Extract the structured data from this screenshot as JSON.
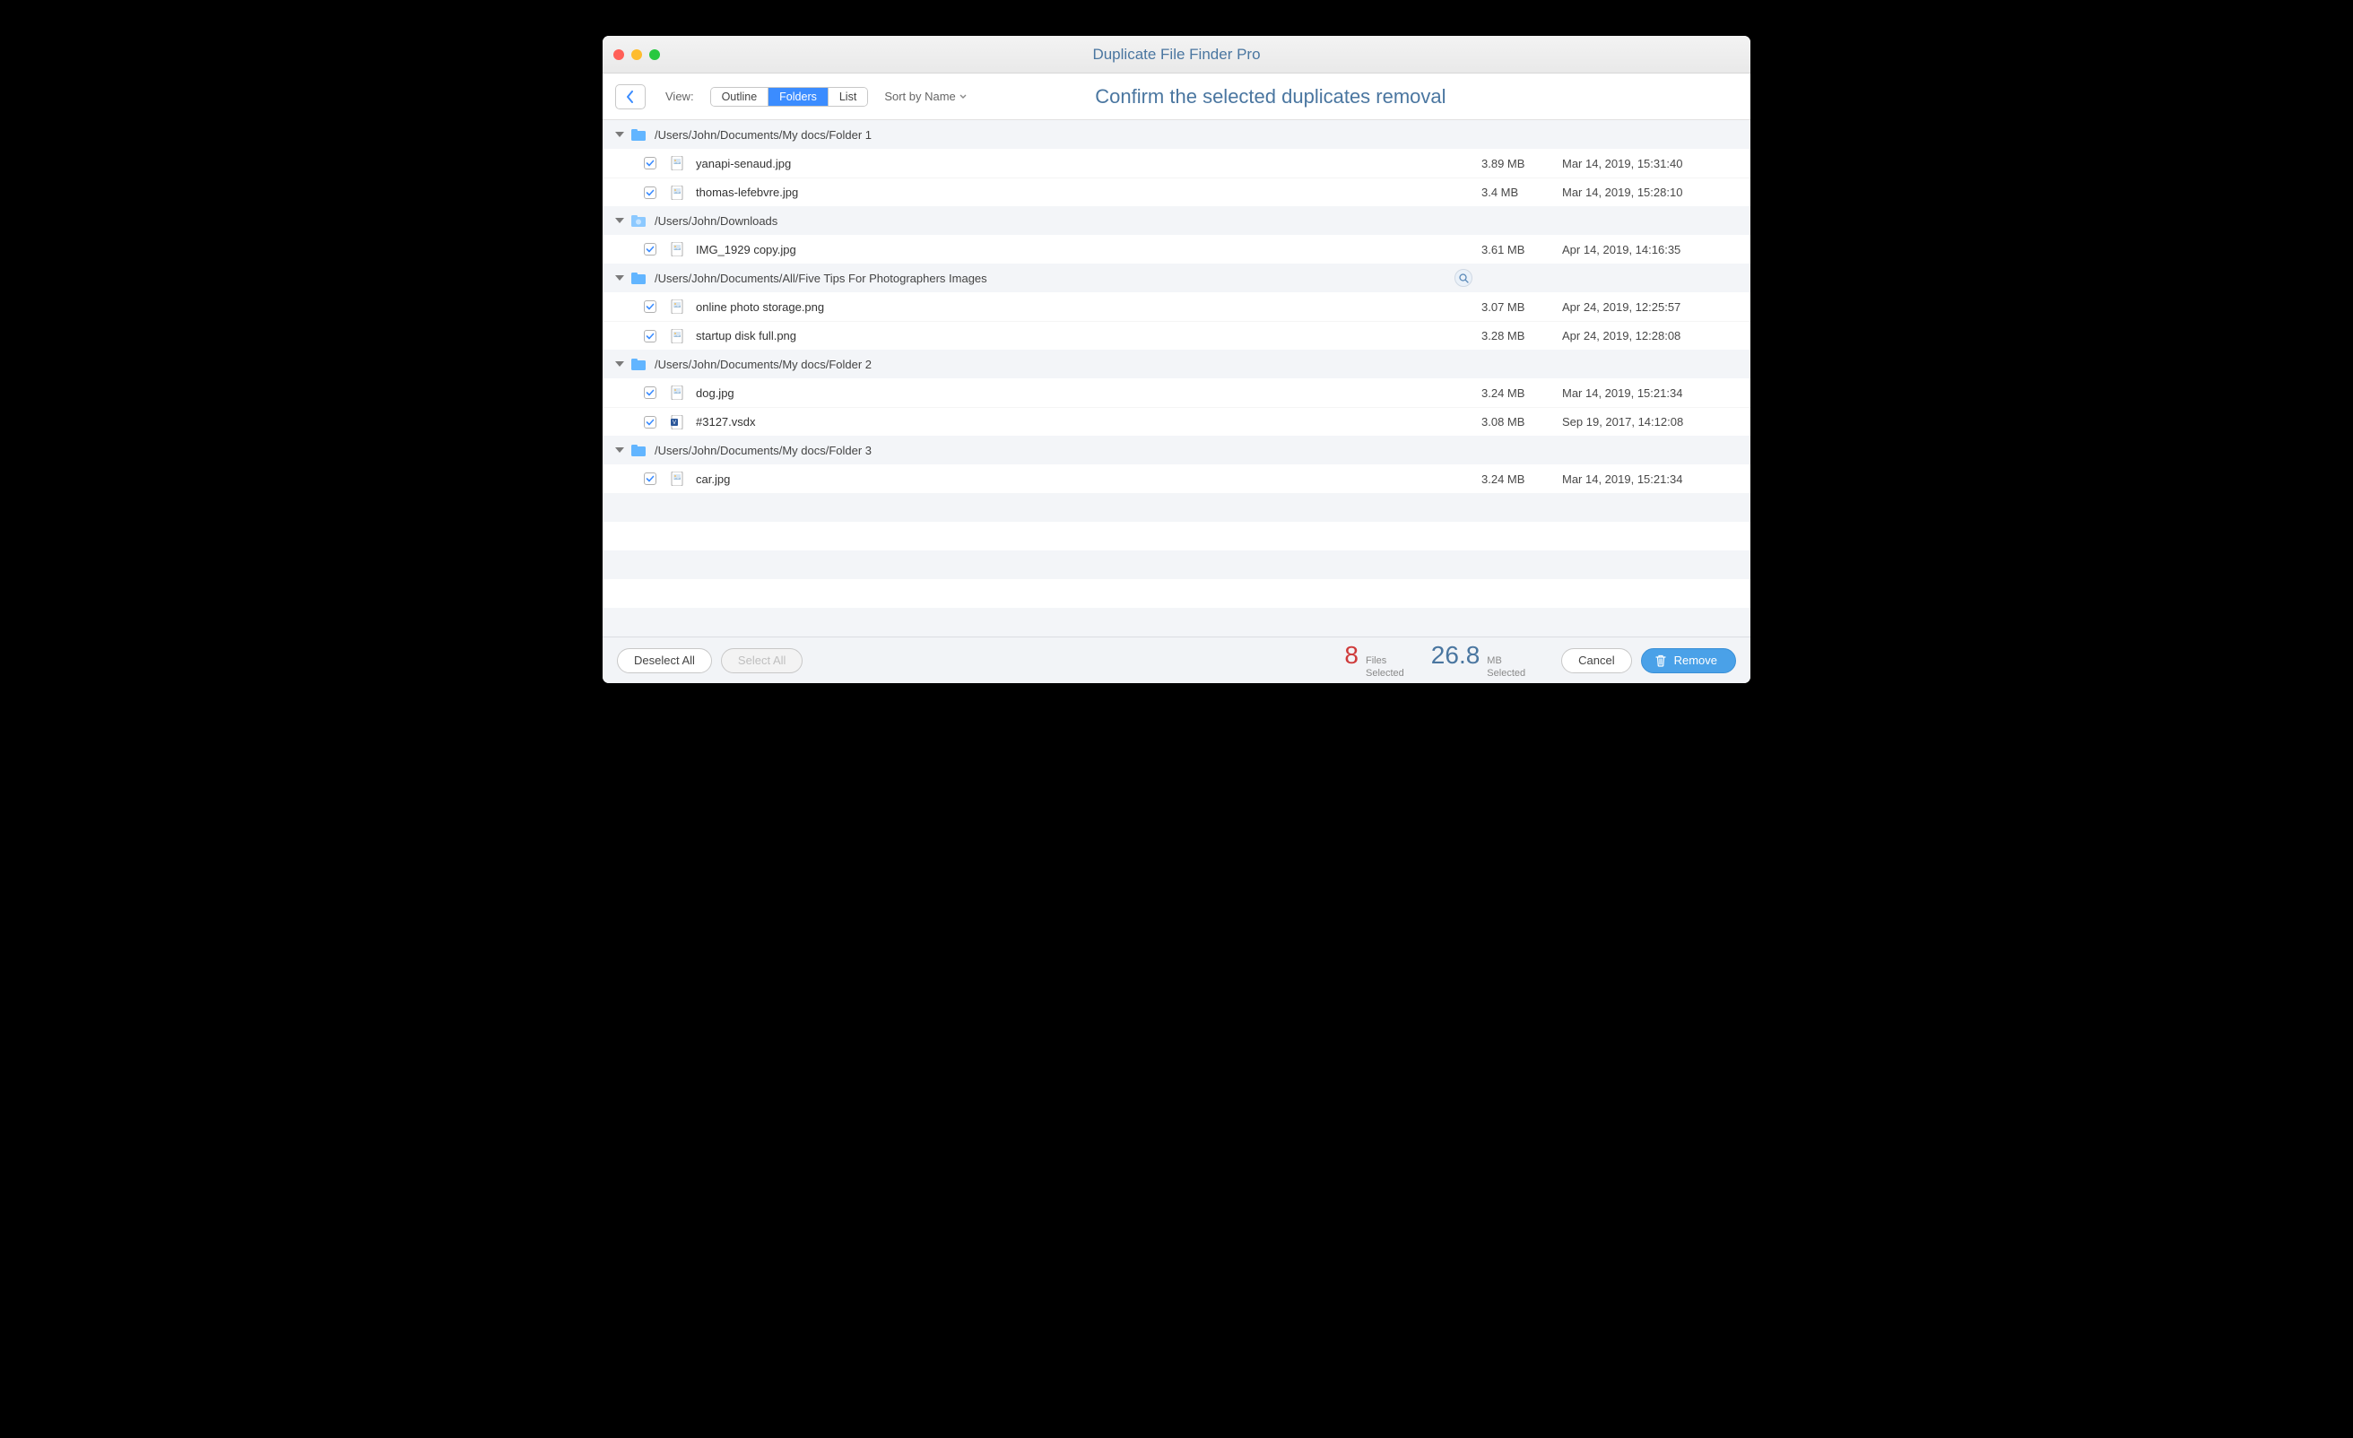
{
  "window": {
    "title": "Duplicate File Finder Pro"
  },
  "toolbar": {
    "view_label": "View:",
    "seg": {
      "outline": "Outline",
      "folders": "Folders",
      "list": "List"
    },
    "sort_label": "Sort by Name",
    "heading": "Confirm the selected duplicates removal"
  },
  "groups": [
    {
      "path": "/Users/John/Documents/My docs/Folder 1",
      "icon": "folder",
      "files": [
        {
          "name": "yanapi-senaud.jpg",
          "size": "3.89 MB",
          "date": "Mar 14, 2019, 15:31:40",
          "type": "image"
        },
        {
          "name": "thomas-lefebvre.jpg",
          "size": "3.4 MB",
          "date": "Mar 14, 2019, 15:28:10",
          "type": "image"
        }
      ]
    },
    {
      "path": "/Users/John/Downloads",
      "icon": "downloads",
      "files": [
        {
          "name": "IMG_1929 copy.jpg",
          "size": "3.61 MB",
          "date": "Apr 14, 2019, 14:16:35",
          "type": "image"
        }
      ]
    },
    {
      "path": "/Users/John/Documents/All/Five Tips For Photographers Images",
      "icon": "folder",
      "magnify": true,
      "files": [
        {
          "name": "online photo storage.png",
          "size": "3.07 MB",
          "date": "Apr 24, 2019, 12:25:57",
          "type": "image"
        },
        {
          "name": "startup disk full.png",
          "size": "3.28 MB",
          "date": "Apr 24, 2019, 12:28:08",
          "type": "image"
        }
      ]
    },
    {
      "path": "/Users/John/Documents/My docs/Folder 2",
      "icon": "folder",
      "files": [
        {
          "name": "dog.jpg",
          "size": "3.24 MB",
          "date": "Mar 14, 2019, 15:21:34",
          "type": "image"
        },
        {
          "name": "#3127.vsdx",
          "size": "3.08 MB",
          "date": "Sep 19, 2017, 14:12:08",
          "type": "visio"
        }
      ]
    },
    {
      "path": "/Users/John/Documents/My docs/Folder 3",
      "icon": "folder",
      "files": [
        {
          "name": "car.jpg",
          "size": "3.24 MB",
          "date": "Mar 14, 2019, 15:21:34",
          "type": "image"
        }
      ]
    }
  ],
  "footer": {
    "deselect": "Deselect All",
    "select": "Select All",
    "files_count": "8",
    "files_label_1": "Files",
    "files_label_2": "Selected",
    "size_val": "26.8",
    "size_unit": "MB",
    "size_label": "Selected",
    "cancel": "Cancel",
    "remove": "Remove"
  }
}
